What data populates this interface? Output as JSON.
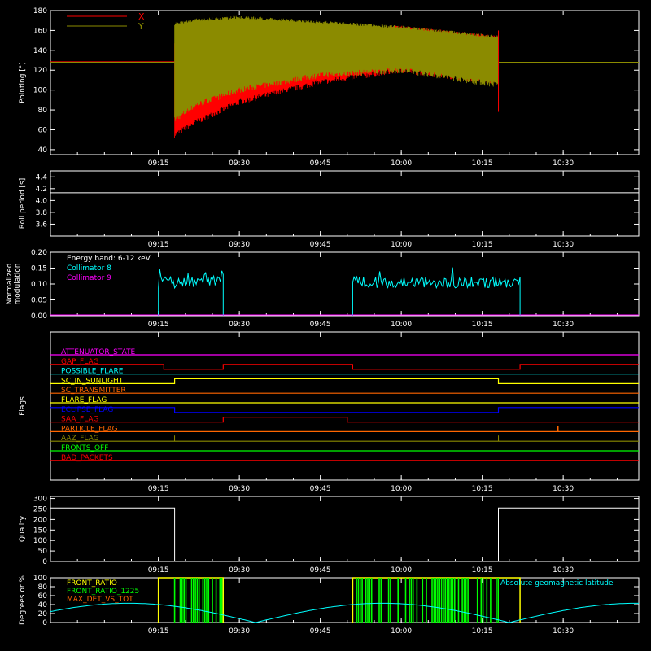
{
  "time_axis": {
    "ticks": [
      "09:15",
      "09:30",
      "09:45",
      "10:00",
      "10:15",
      "10:30"
    ]
  },
  "chart_data": [
    {
      "id": "pointing",
      "type": "line",
      "ylabel": "Pointing [°]",
      "ylim": [
        35,
        180
      ],
      "yticks": [
        "40",
        "60",
        "80",
        "100",
        "120",
        "140",
        "160",
        "180"
      ],
      "legend": [
        {
          "name": "X",
          "color": "#ff0000"
        },
        {
          "name": "Y",
          "color": "#8b8b00"
        }
      ],
      "reference_value": 128,
      "x_envelope": {
        "t": [
          "09:18",
          "09:22",
          "09:30",
          "09:45",
          "10:00",
          "10:18"
        ],
        "min": [
          55,
          68,
          88,
          108,
          120,
          108
        ],
        "max": [
          150,
          152,
          158,
          162,
          165,
          155
        ]
      },
      "y_envelope": {
        "t": [
          "09:18",
          "09:22",
          "09:30",
          "09:45",
          "10:00",
          "10:18"
        ],
        "min": [
          70,
          85,
          100,
          115,
          120,
          105
        ],
        "max": [
          168,
          172,
          175,
          170,
          165,
          155
        ]
      }
    },
    {
      "id": "roll",
      "type": "line",
      "ylabel": "Roll period [s]",
      "ylim": [
        3.4,
        4.5
      ],
      "yticks": [
        "3.6",
        "3.8",
        "4.0",
        "4.2",
        "4.4"
      ],
      "value": 4.13
    },
    {
      "id": "modulation",
      "type": "line",
      "ylabel_lines": [
        "Normalized",
        "modulation"
      ],
      "ylim": [
        0,
        0.2
      ],
      "yticks": [
        "0.00",
        "0.05",
        "0.10",
        "0.15",
        "0.20"
      ],
      "annotation": "Energy band: 6-12 keV",
      "series": [
        {
          "name": "Collimator 8",
          "color": "#00ffff",
          "intervals": [
            [
              "09:15",
              "09:27"
            ],
            [
              "09:51",
              "10:22"
            ]
          ],
          "mean": 0.105
        },
        {
          "name": "Collimator 9",
          "color": "#ff00ff",
          "value": 0
        }
      ]
    },
    {
      "id": "flags",
      "type": "line",
      "ylabel": "Flags",
      "series": [
        {
          "name": "ATTENUATOR_STATE",
          "color": "#ff00ff",
          "segments": [
            [
              "08:55",
              "10:44",
              0
            ]
          ]
        },
        {
          "name": "GAP_FLAG",
          "color": "#ff0000",
          "segments": [
            [
              "08:55",
              "09:16",
              0
            ],
            [
              "09:16",
              "09:27",
              -1
            ],
            [
              "09:27",
              "09:51",
              0
            ],
            [
              "09:51",
              "10:22",
              -1
            ],
            [
              "10:22",
              "10:44",
              0
            ]
          ]
        },
        {
          "name": "POSSIBLE_FLARE",
          "color": "#00ffff",
          "segments": [
            [
              "08:55",
              "10:44",
              0
            ]
          ]
        },
        {
          "name": "SC_IN_SUNLIGHT",
          "color": "#ffff00",
          "segments": [
            [
              "08:55",
              "09:18",
              0
            ],
            [
              "09:18",
              "10:18",
              1
            ],
            [
              "10:18",
              "10:44",
              0
            ]
          ]
        },
        {
          "name": "SC_TRANSMITTER",
          "color": "#ff6600",
          "segments": [
            [
              "08:55",
              "10:44",
              0
            ]
          ]
        },
        {
          "name": "FLARE_FLAG",
          "color": "#ffff00",
          "segments": [
            [
              "08:55",
              "10:44",
              0
            ]
          ]
        },
        {
          "name": "ECLIPSE_FLAG",
          "color": "#0000ff",
          "segments": [
            [
              "08:55",
              "09:18",
              1
            ],
            [
              "09:18",
              "10:18",
              0
            ],
            [
              "10:18",
              "10:44",
              1
            ]
          ]
        },
        {
          "name": "SAA_FLAG",
          "color": "#ff0000",
          "segments": [
            [
              "08:55",
              "09:27",
              0
            ],
            [
              "09:27",
              "09:50",
              1
            ],
            [
              "09:50",
              "10:44",
              0
            ]
          ]
        },
        {
          "name": "PARTICLE_FLAG",
          "color": "#ff6600",
          "segments": [
            [
              "08:55",
              "10:44",
              0
            ]
          ],
          "spikes": [
            "10:29"
          ]
        },
        {
          "name": "AAZ_FLAG",
          "color": "#8b8b00",
          "segments": [
            [
              "08:55",
              "10:44",
              0
            ]
          ],
          "spikes": [
            "09:18",
            "10:18"
          ]
        },
        {
          "name": "FRONTS_OFF",
          "color": "#00ff00",
          "segments": [
            [
              "08:55",
              "10:44",
              0
            ]
          ]
        },
        {
          "name": "BAD_PACKETS",
          "color": "#ff0000",
          "segments": [
            [
              "08:55",
              "10:44",
              0
            ]
          ]
        }
      ]
    },
    {
      "id": "quality",
      "type": "line",
      "ylabel": "Quality",
      "ylim": [
        0,
        310
      ],
      "yticks": [
        "0",
        "50",
        "100",
        "150",
        "200",
        "250",
        "300"
      ],
      "segments": [
        [
          "08:55",
          "09:18",
          255
        ],
        [
          "09:18",
          "10:18",
          0
        ],
        [
          "10:18",
          "10:44",
          255
        ]
      ]
    },
    {
      "id": "degrees",
      "type": "line",
      "ylabel": "Degrees or %",
      "ylim": [
        0,
        100
      ],
      "yticks": [
        "0",
        "20",
        "40",
        "60",
        "80",
        "100"
      ],
      "series": [
        {
          "name": "FRONT_RATIO",
          "color": "#ffff00",
          "intervals": [
            [
              "09:15",
              "09:27"
            ],
            [
              "09:51",
              "10:22"
            ]
          ]
        },
        {
          "name": "FRONT_RATIO_1225",
          "color": "#00ff00",
          "intervals": [
            [
              "09:18",
              "09:27"
            ],
            [
              "09:51",
              "10:18"
            ]
          ]
        },
        {
          "name": "MAX_DET_VS_TOT",
          "color": "#ff6600"
        },
        {
          "name": "Absolute geomagnetic latitude",
          "color": "#00ffff",
          "amplitude": 43,
          "period_minutes": 47,
          "zero_time": "09:33"
        }
      ]
    }
  ]
}
